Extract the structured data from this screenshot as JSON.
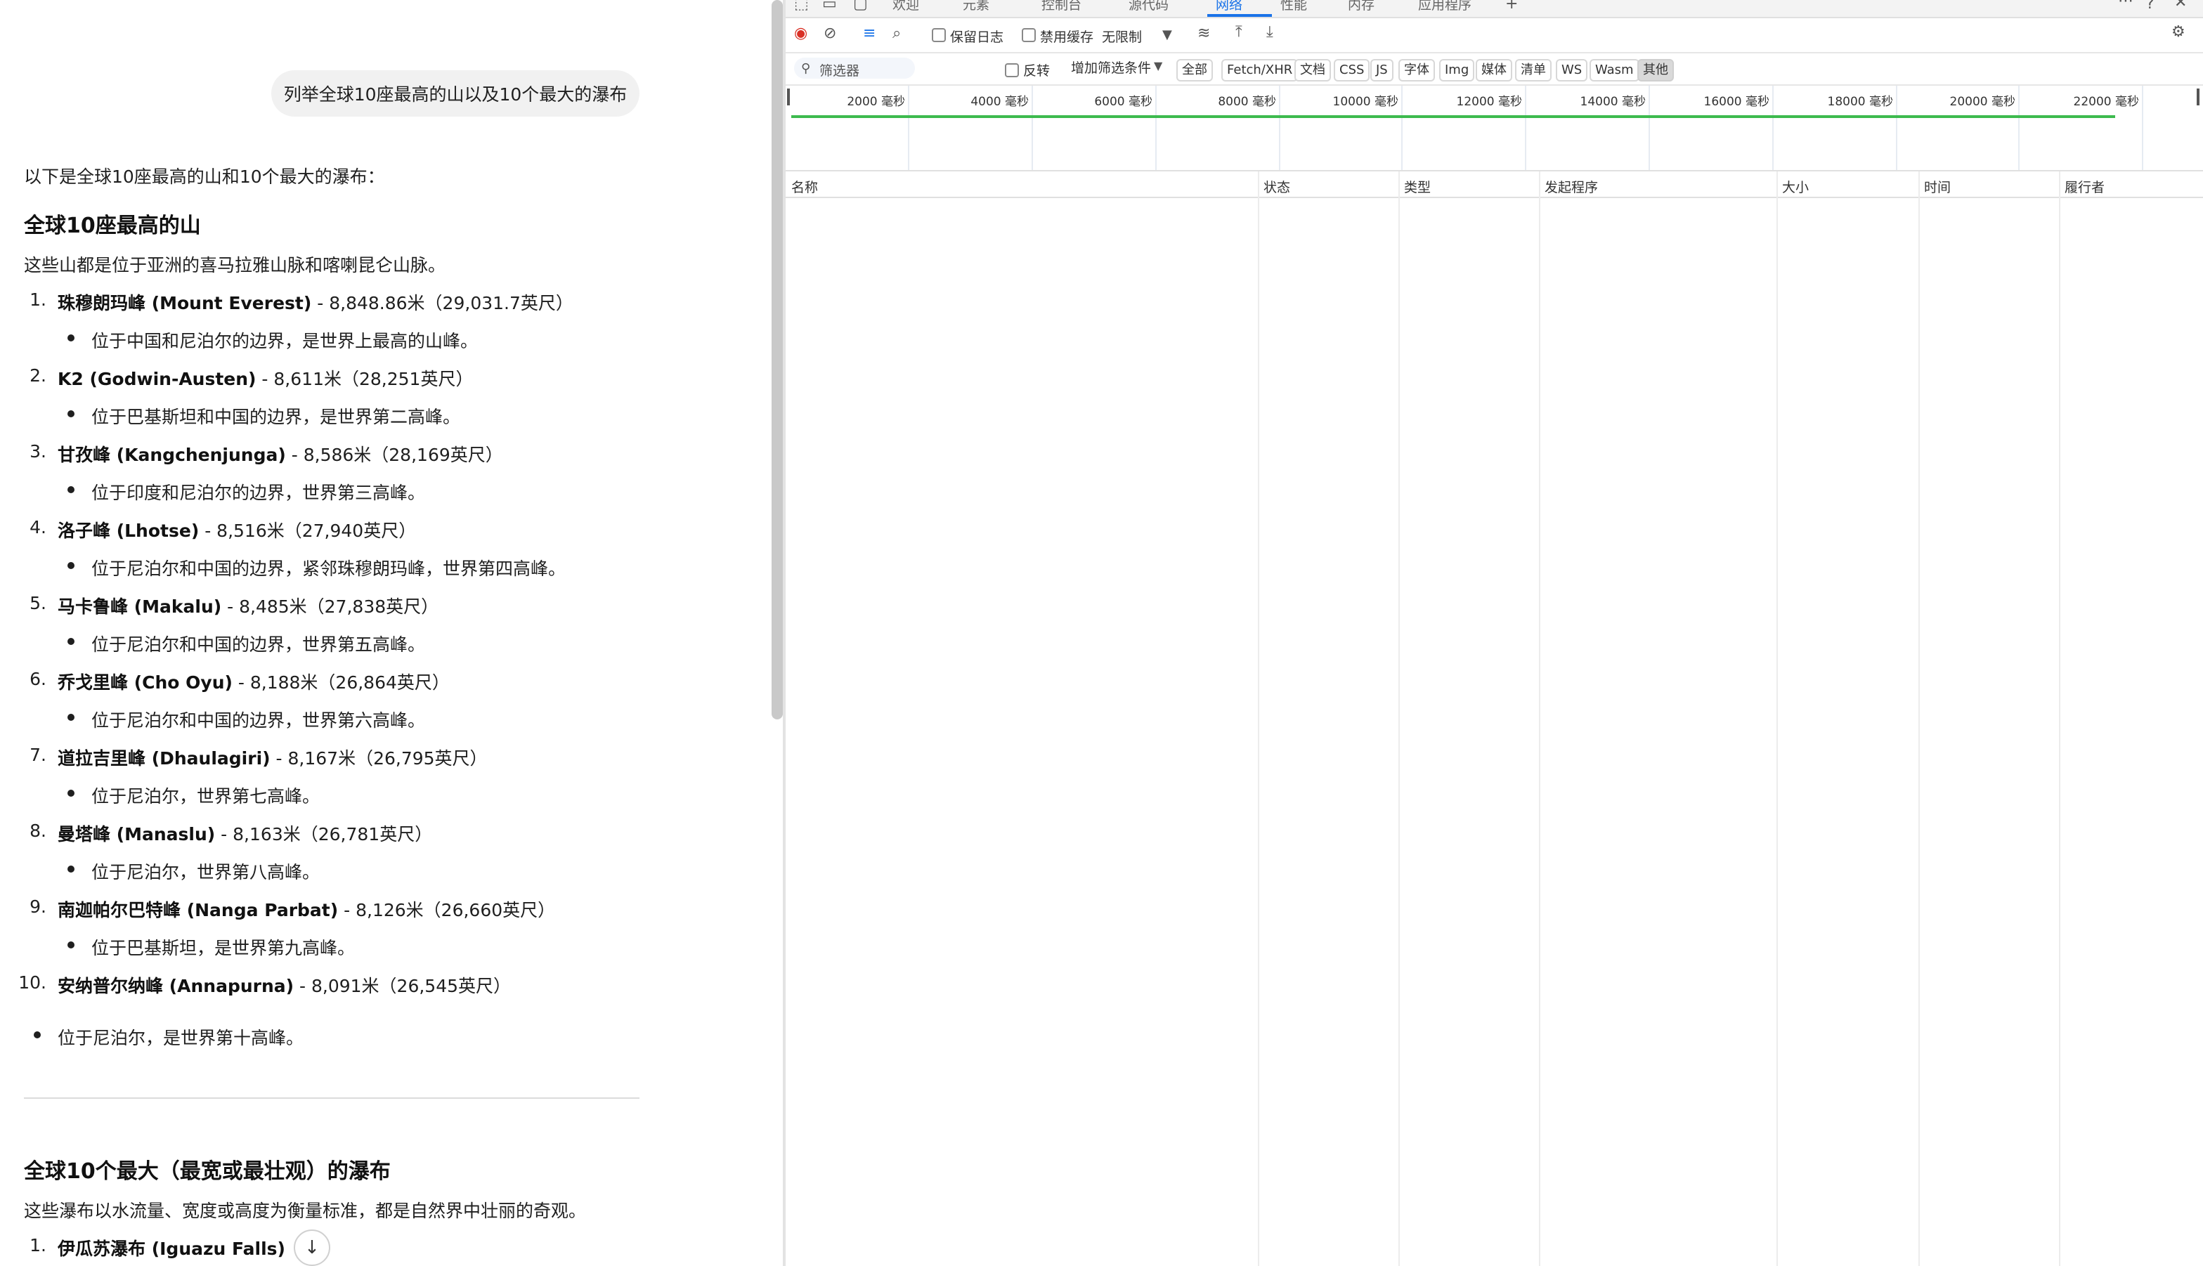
{
  "chat": {
    "user_message": "列举全球10座最高的山以及10个最大的瀑布",
    "intro": "以下是全球10座最高的山和10个最大的瀑布：",
    "mountains_heading": "全球10座最高的山",
    "mountains_desc": "这些山都是位于亚洲的喜马拉雅山脉和喀喇昆仑山脉。",
    "mountains": [
      {
        "num": "1.",
        "name": "珠穆朗玛峰 (Mount Everest)",
        "detail": " - 8,848.86米（29,031.7英尺）",
        "note": "位于中国和尼泊尔的边界，是世界上最高的山峰。"
      },
      {
        "num": "2.",
        "name": "K2 (Godwin-Austen)",
        "detail": " - 8,611米（28,251英尺）",
        "note": "位于巴基斯坦和中国的边界，是世界第二高峰。"
      },
      {
        "num": "3.",
        "name": "甘孜峰 (Kangchenjunga)",
        "detail": " - 8,586米（28,169英尺）",
        "note": "位于印度和尼泊尔的边界，世界第三高峰。"
      },
      {
        "num": "4.",
        "name": "洛子峰 (Lhotse)",
        "detail": " - 8,516米（27,940英尺）",
        "note": "位于尼泊尔和中国的边界，紧邻珠穆朗玛峰，世界第四高峰。"
      },
      {
        "num": "5.",
        "name": "马卡鲁峰 (Makalu)",
        "detail": " - 8,485米（27,838英尺）",
        "note": "位于尼泊尔和中国的边界，世界第五高峰。"
      },
      {
        "num": "6.",
        "name": "乔戈里峰 (Cho Oyu)",
        "detail": " - 8,188米（26,864英尺）",
        "note": "位于尼泊尔和中国的边界，世界第六高峰。"
      },
      {
        "num": "7.",
        "name": "道拉吉里峰 (Dhaulagiri)",
        "detail": " - 8,167米（26,795英尺）",
        "note": "位于尼泊尔，世界第七高峰。"
      },
      {
        "num": "8.",
        "name": "曼塔峰 (Manaslu)",
        "detail": " - 8,163米（26,781英尺）",
        "note": "位于尼泊尔，世界第八高峰。"
      },
      {
        "num": "9.",
        "name": "南迦帕尔巴特峰 (Nanga Parbat)",
        "detail": " - 8,126米（26,660英尺）",
        "note": "位于巴基斯坦，是世界第九高峰。"
      },
      {
        "num": "10.",
        "name": "安纳普尔纳峰 (Annapurna)",
        "detail": " - 8,091米（26,545英尺）",
        "note": "位于尼泊尔，是世界第十高峰。"
      }
    ],
    "waterfalls_heading": "全球10个最大（最宽或最壮观）的瀑布",
    "waterfalls_desc": "这些瀑布以水流量、宽度或高度为衡量标准，都是自然界中壮丽的奇观。",
    "waterfalls": [
      {
        "num": "1.",
        "name": "伊瓜苏瀑布 (Iguazu Falls)"
      }
    ],
    "scroll_down_icon": "arrow-down-icon"
  },
  "devtools": {
    "tabs": [
      "欢迎",
      "元素",
      "控制台",
      "源代码",
      "网络",
      "性能",
      "内存",
      "应用程序"
    ],
    "active_tab": "网络",
    "toolbar": {
      "preserve_log": "保留日志",
      "disable_cache": "禁用缓存",
      "throttle": "无限制"
    },
    "filter": {
      "placeholder": "筛选器",
      "invert": "反转",
      "more_filters": "增加筛选条件",
      "types": [
        "全部",
        "Fetch/XHR",
        "文档",
        "CSS",
        "JS",
        "字体",
        "Img",
        "媒体",
        "清单",
        "WS",
        "Wasm",
        "其他"
      ],
      "selected_type": "其他"
    },
    "timeline_ticks": [
      "2000 毫秒",
      "4000 毫秒",
      "6000 毫秒",
      "8000 毫秒",
      "10000 毫秒",
      "12000 毫秒",
      "14000 毫秒",
      "16000 毫秒",
      "18000 毫秒",
      "20000 毫秒",
      "22000 毫秒"
    ],
    "columns": [
      "名称",
      "状态",
      "类型",
      "发起程序",
      "大小",
      "时间",
      "履行者"
    ],
    "colors": {
      "accent": "#1a73e8",
      "record": "#d93025",
      "timeline_green": "#3dba4e"
    }
  }
}
